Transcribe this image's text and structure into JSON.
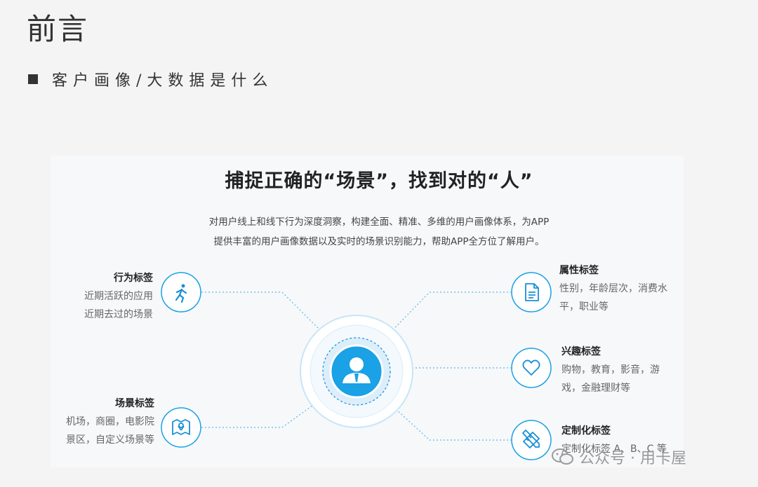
{
  "header": {
    "title": "前言",
    "section_heading": "客户画像/大数据是什么"
  },
  "card": {
    "title": "捕捉正确的“场景”，找到对的“人”",
    "description_line1": "对用户线上和线下行为深度洞察，构建全面、精准、多维的用户画像体系，为APP",
    "description_line2": "提供丰富的用户画像数据以及实时的场景识别能力，帮助APP全方位了解用户。"
  },
  "tags": {
    "behavior": {
      "title": "行为标签",
      "line1": "近期活跃的应用",
      "line2": "近期去过的场景",
      "icon": "running-person-icon"
    },
    "scene": {
      "title": "场景标签",
      "line1": "机场，商圈，电影院",
      "line2": "景区，自定义场景等",
      "icon": "map-pin-icon"
    },
    "attribute": {
      "title": "属性标签",
      "line1": "性别，年龄层次，消费水",
      "line2": "平，职业等",
      "icon": "document-icon"
    },
    "interest": {
      "title": "兴趣标签",
      "line1": "购物，教育，影音，游",
      "line2": "戏，金融理财等",
      "icon": "heart-icon"
    },
    "custom": {
      "title": "定制化标签",
      "line1": "定制化标签 A、B、C 等",
      "icon": "pencil-ruler-icon"
    }
  },
  "center": {
    "icon": "user-avatar-icon"
  },
  "watermark": {
    "text": "公众号 · 用卡屋",
    "icon": "wechat-icon"
  },
  "colors": {
    "accent": "#1aa1e6",
    "ring": "#bfe3f7",
    "line": "#5bb8e8"
  }
}
